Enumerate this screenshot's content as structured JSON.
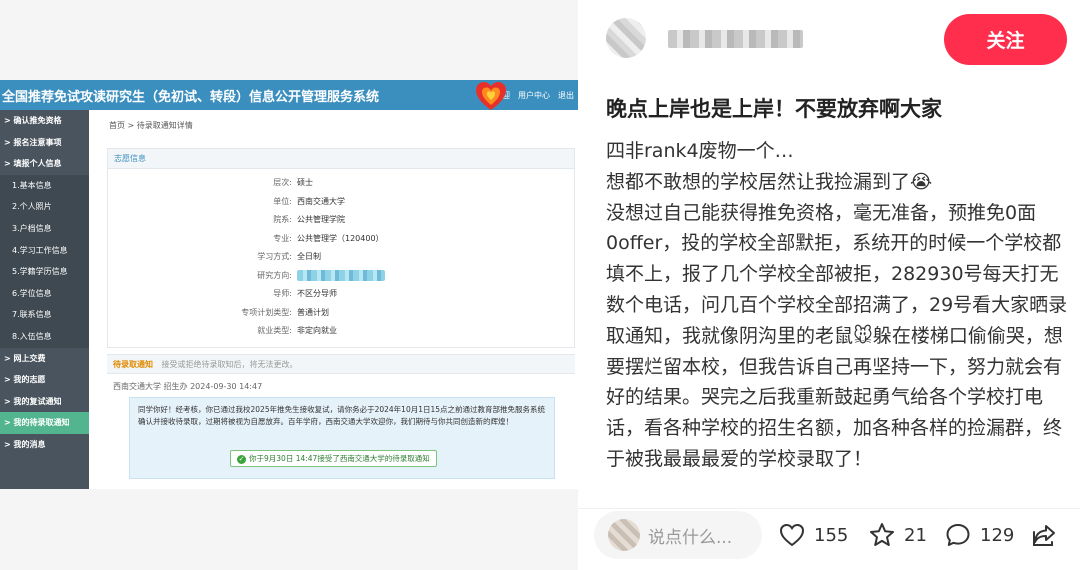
{
  "screenshot": {
    "system_title": "全国推荐免试攻读研究生（免初试、转段）信息公开管理服务系统",
    "header_links": [
      "欢迎",
      "用户中心",
      "退出"
    ],
    "sidebar": [
      {
        "label": "> 确认推免资格",
        "type": "bold"
      },
      {
        "label": "> 报名注意事项",
        "type": "bold"
      },
      {
        "label": "> 填报个人信息",
        "type": "bold"
      },
      {
        "label": "1.基本信息",
        "type": "sub"
      },
      {
        "label": "2.个人照片",
        "type": "sub"
      },
      {
        "label": "3.户档信息",
        "type": "sub"
      },
      {
        "label": "4.学习工作信息",
        "type": "sub"
      },
      {
        "label": "5.学籍学历信息",
        "type": "sub"
      },
      {
        "label": "6.学位信息",
        "type": "sub"
      },
      {
        "label": "7.联系信息",
        "type": "sub"
      },
      {
        "label": "8.入伍信息",
        "type": "sub"
      },
      {
        "label": "> 网上交费",
        "type": "bold"
      },
      {
        "label": "> 我的志愿",
        "type": "bold"
      },
      {
        "label": "> 我的复试通知",
        "type": "bold"
      },
      {
        "label": "> 我的待录取通知",
        "type": "active"
      },
      {
        "label": "> 我的消息",
        "type": "bold"
      }
    ],
    "breadcrumb": "首页 > 待录取通知详情",
    "volunteer_title": "志愿信息",
    "fields": [
      {
        "k": "层次:",
        "v": "硕士"
      },
      {
        "k": "单位:",
        "v": "西南交通大学"
      },
      {
        "k": "院系:",
        "v": "公共管理学院"
      },
      {
        "k": "专业:",
        "v": "公共管理学（120400）"
      },
      {
        "k": "学习方式:",
        "v": "全日制"
      },
      {
        "k": "研究方向:",
        "v": ""
      },
      {
        "k": "导师:",
        "v": "不区分导师"
      },
      {
        "k": "专项计划类型:",
        "v": "普通计划"
      },
      {
        "k": "就业类型:",
        "v": "非定向就业"
      }
    ],
    "wait_title": "待录取通知",
    "wait_note": "接受或拒绝待录取知后，将无法更改。",
    "wait_meta": "西南交通大学 招生办 2024-09-30 14:47",
    "message": "同学你好！经考核，你已通过我校2025年推免生接收复试，请你务必于2024年10月1日15点之前通过教育部推免服务系统确认并接收待录取，过期将被视为自愿放弃。百年学府，西南交通大学欢迎你，我们期待与你共同创造新的辉煌！",
    "accept_text": "你于9月30日 14:47接受了西南交通大学的待录取通知"
  },
  "note": {
    "follow_label": "关注",
    "title": "晚点上岸也是上岸！不要放弃啊大家",
    "paragraphs": [
      "四非rank4废物一个…",
      "想都不敢想的学校居然让我捡漏到了😭",
      "没想过自己能获得推免资格，毫无准备，预推免0面0offer，投的学校全部默拒，系统开的时候一个学校都填不上，报了几个学校全部被拒，282930号每天打无数个电话，问几百个学校全部招满了，29号看大家晒录取通知，我就像阴沟里的老鼠🐭躲在楼梯口偷偷哭，想要摆烂留本校，但我告诉自己再坚持一下，努力就会有好的结果。哭完之后我重新鼓起勇气给各个学校打电话，看各种学校的招生名额，加各种各样的捡漏群，终于被我最最最爱的学校录取了！"
    ],
    "comment_placeholder": "说点什么...",
    "likes": "155",
    "collects": "21",
    "comments": "129"
  },
  "colors": {
    "header_blue": "#3b8fbf",
    "sidebar_bg": "#4a545e",
    "sidebar_active": "#53b58f",
    "follow_red": "#ff2e4d"
  }
}
